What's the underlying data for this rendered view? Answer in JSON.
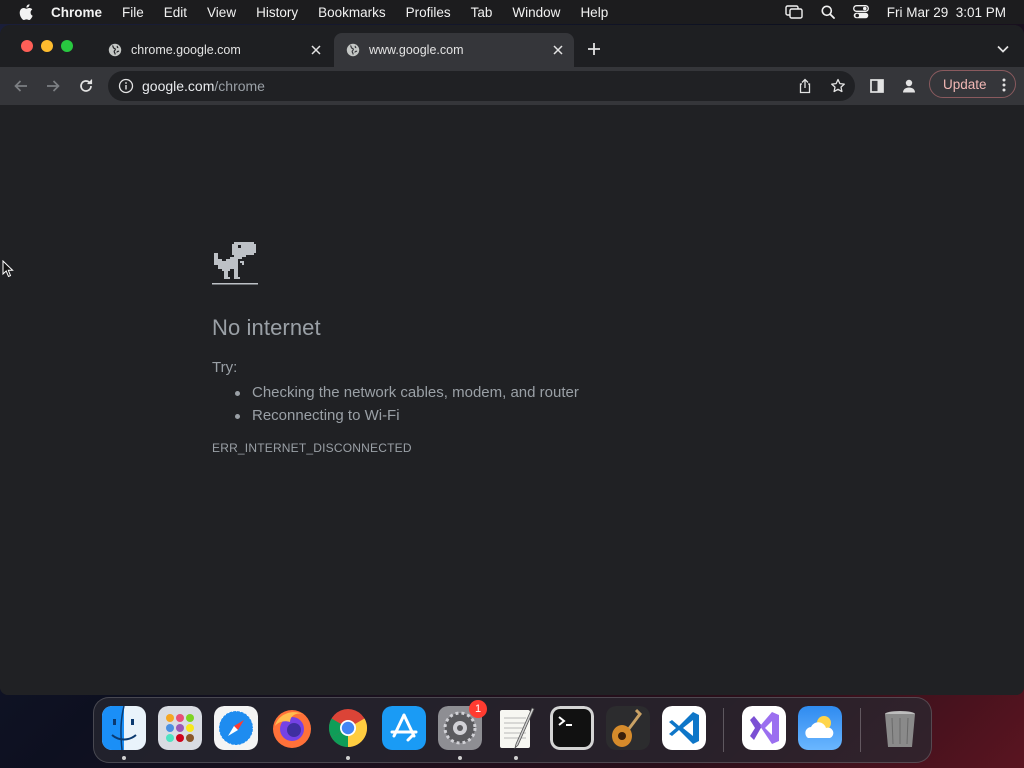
{
  "menubar": {
    "app_name": "Chrome",
    "items": [
      "File",
      "Edit",
      "View",
      "History",
      "Bookmarks",
      "Profiles",
      "Tab",
      "Window",
      "Help"
    ],
    "clock": "Fri Mar 29  3:01 PM"
  },
  "tabs": [
    {
      "title": "chrome.google.com",
      "active": false
    },
    {
      "title": "www.google.com",
      "active": true
    }
  ],
  "toolbar": {
    "url_host": "google.com",
    "url_path": "/chrome",
    "update_label": "Update"
  },
  "error_page": {
    "title": "No internet",
    "try_label": "Try:",
    "suggestions": [
      "Checking the network cables, modem, and router",
      "Reconnecting to Wi-Fi"
    ],
    "error_code": "ERR_INTERNET_DISCONNECTED"
  },
  "dock": {
    "apps": [
      "finder",
      "launchpad",
      "safari",
      "firefox",
      "chrome",
      "app-store",
      "system-settings",
      "textedit",
      "terminal",
      "garageband",
      "vscode",
      "visual-studio",
      "weather",
      "trash"
    ],
    "system_settings_badge": "1"
  },
  "colors": {
    "page_bg": "#202124",
    "toolbar_bg": "#35363a",
    "text_muted": "#9aa0a6",
    "update_accent": "#f2b8b5"
  }
}
